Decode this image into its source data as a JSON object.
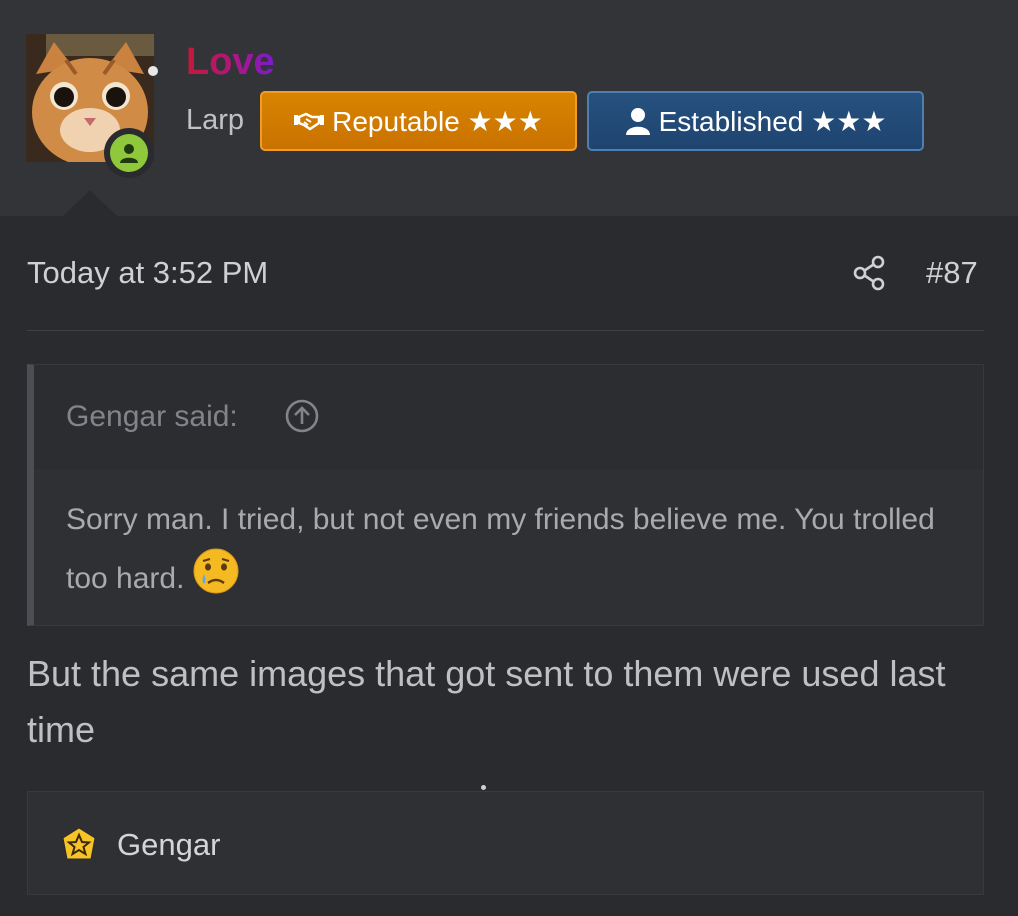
{
  "post": {
    "author": {
      "username": "Love",
      "title": "Larp",
      "avatar_icon": "cat-avatar",
      "status_icon": "user-icon"
    },
    "badges": [
      {
        "label": "Reputable ★★★",
        "icon": "handshake-icon",
        "color": "#d88400"
      },
      {
        "label": "Established ★★★",
        "icon": "user-icon",
        "color": "#26517e"
      }
    ],
    "timestamp": "Today at 3:52 PM",
    "number": "#87",
    "quote": {
      "author_line": "Gengar said:",
      "text": "Sorry man. I tried, but not even my friends believe me. You trolled too hard.",
      "emoji": "crying-face-emoji"
    },
    "message": "But the same images that got sent to them were used last time",
    "reactions": {
      "icon": "star-badge-icon",
      "users": "Gengar"
    }
  }
}
